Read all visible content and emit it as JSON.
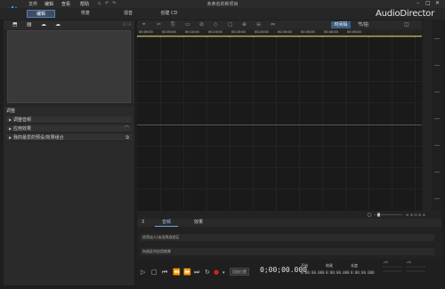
{
  "menu": {
    "items": [
      "文件",
      "编辑",
      "查看",
      "帮助"
    ]
  },
  "window": {
    "title": "未命名的新项目"
  },
  "modes": {
    "tabs": [
      "编辑",
      "恢复",
      "混音",
      "创建 CD"
    ],
    "active_index": 0
  },
  "brand": "AudioDirector",
  "library": {
    "counter": "0 / 0"
  },
  "adjust": {
    "title": "调整",
    "rows": [
      "调整音频",
      "应用效果",
      "我的最爱的预设/效果组合"
    ]
  },
  "editor": {
    "view_tabs": [
      "时间码",
      "节/拍"
    ],
    "active_view": 0,
    "ruler_ticks": [
      "00:00:00",
      "00:05:00",
      "00:10:00",
      "00:15:00",
      "00:20:00",
      "00:25:00",
      "00:30:00",
      "00:35:00",
      "00:40:00",
      "00:45:00"
    ]
  },
  "panel_tabs": {
    "tabs": [
      "音频",
      "效果"
    ],
    "active_index": 0
  },
  "properties": {
    "rows": [
      "应用淡入/淡出到选定区",
      "向选区内应用效果"
    ]
  },
  "transport": {
    "timecode": "0;00;00.000",
    "chip_label": "回放位置",
    "start_label": "开始",
    "start_value": "0:00:00.000",
    "end_label": "结尾",
    "end_value": "0:00:00.000",
    "length_label": "长度",
    "length_value": "0:00:00.000",
    "vu_labels": [
      "-dB",
      "-dB"
    ]
  },
  "colors": {
    "accent": "#3d5c80",
    "ruler_line": "#c9a82c",
    "record": "#d42020"
  }
}
